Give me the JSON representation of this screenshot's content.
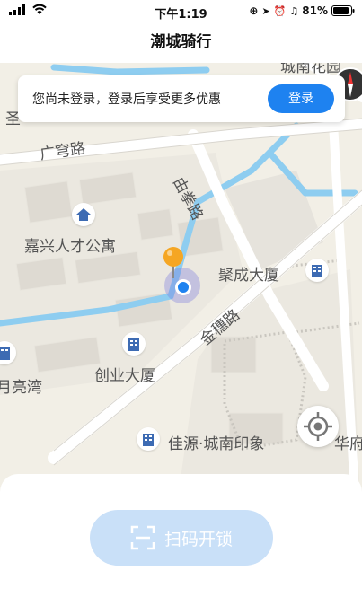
{
  "status_bar": {
    "time": "下午1:19",
    "battery": "81%"
  },
  "nav": {
    "title": "潮城骑行"
  },
  "login_banner": {
    "message": "您尚未登录，登录后享受更多优惠",
    "button": "登录"
  },
  "map": {
    "road_labels": [
      {
        "name": "广穹路"
      },
      {
        "name": "由拳路"
      },
      {
        "name": "金穗路"
      }
    ],
    "pois": [
      {
        "name": "嘉兴人才公寓"
      },
      {
        "name": "聚成大厦"
      },
      {
        "name": "创业大厦"
      },
      {
        "name": "佳源·城南印象"
      },
      {
        "name": "月亮湾"
      },
      {
        "name": "华府"
      },
      {
        "name": "城南花园"
      },
      {
        "name": "圣"
      }
    ]
  },
  "bottom_sheet": {
    "scan_button": "扫码开锁"
  },
  "colors": {
    "accent": "#1E82F0",
    "pin": "#F5A623",
    "water": "#8ECDF0",
    "map_bg": "#F2EFE6"
  }
}
